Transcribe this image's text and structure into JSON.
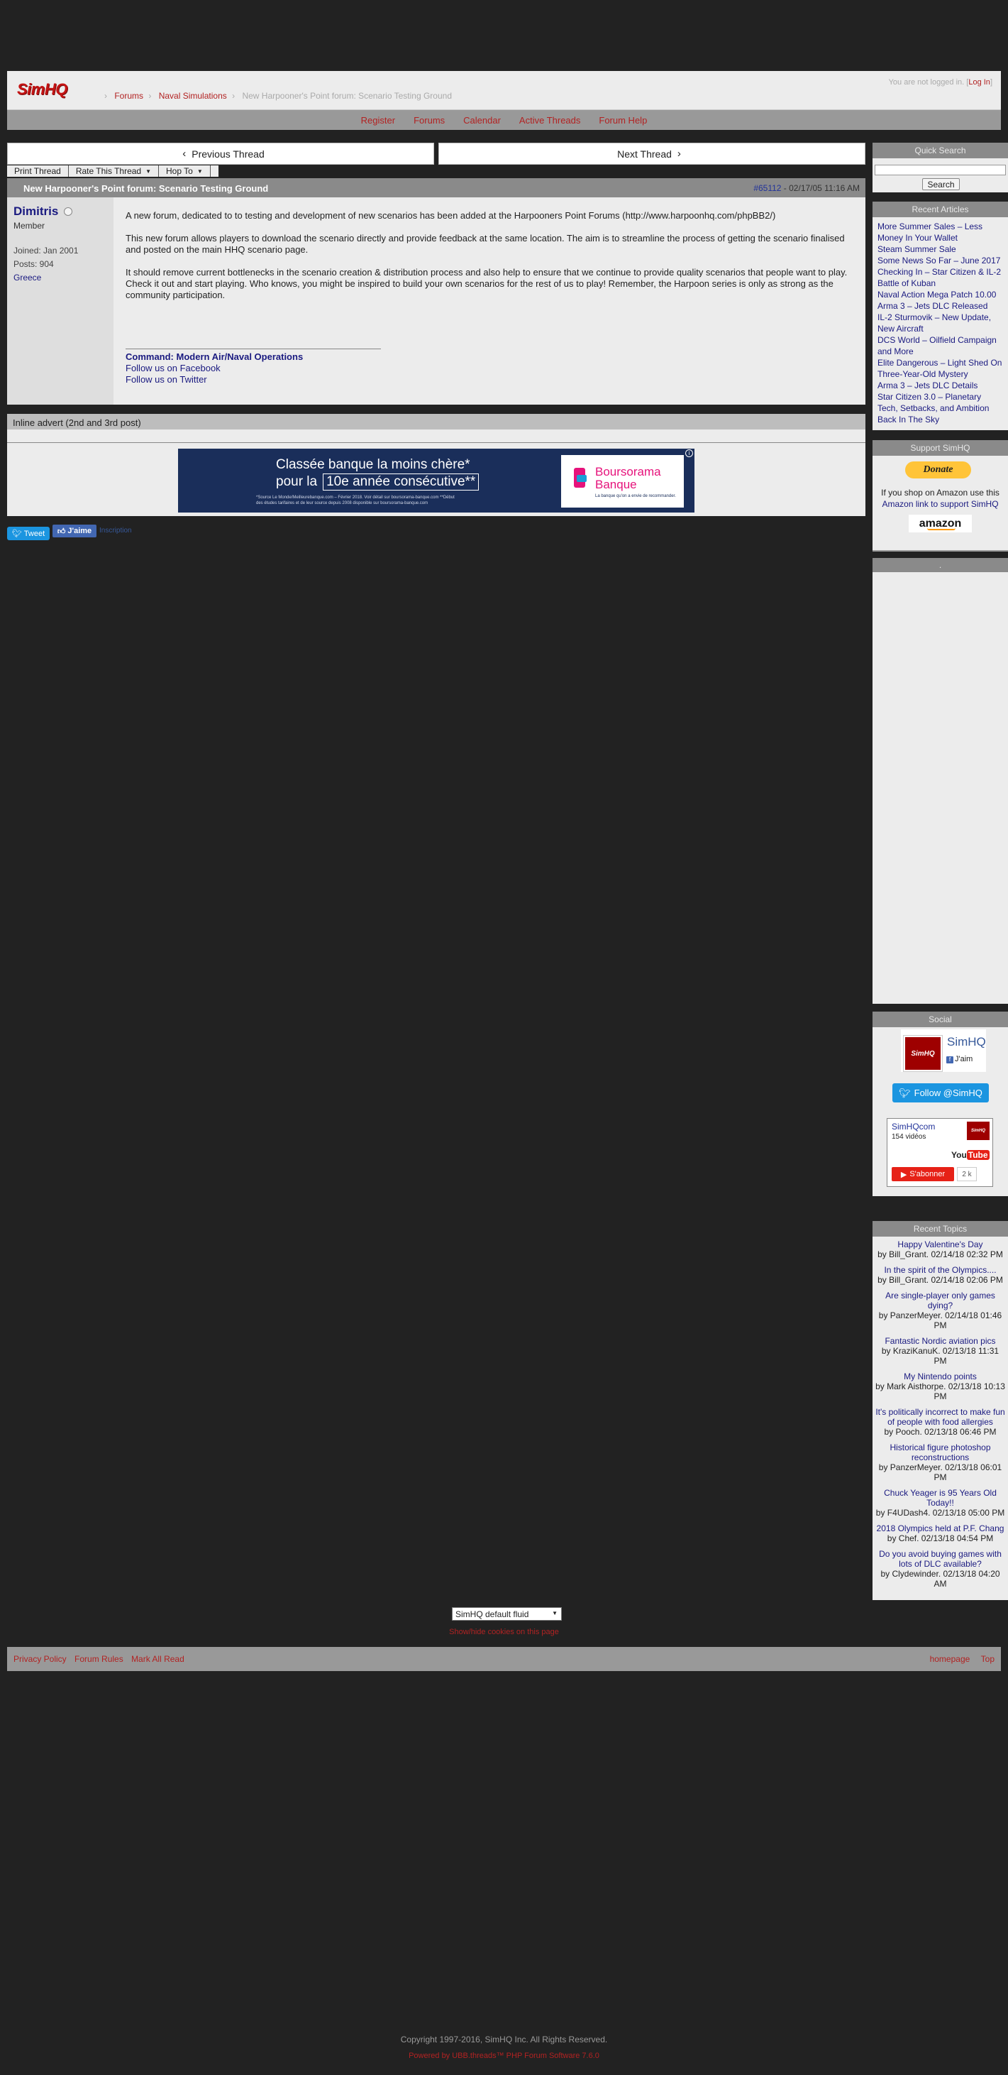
{
  "header": {
    "logo": "SimHQ",
    "breadcrumbs": [
      "Forums",
      "Naval Simulations"
    ],
    "current_page": "New Harpooner's Point forum: Scenario Testing Ground",
    "login_prefix": "You are not logged in. [",
    "login_link": "Log In",
    "login_suffix": "]"
  },
  "navbar": {
    "items": [
      "Register",
      "Forums",
      "Calendar",
      "Active Threads",
      "Forum Help"
    ]
  },
  "thread_nav": {
    "prev": "Previous Thread",
    "next": "Next Thread",
    "prev_icon": "‹",
    "next_icon": "›"
  },
  "tools": {
    "print": "Print Thread",
    "rate": "Rate This Thread",
    "hop": "Hop To"
  },
  "post": {
    "title": "New Harpooner's Point forum: Scenario Testing Ground",
    "number": "#65112",
    "date": " - 02/17/05 11:16 AM",
    "user": {
      "name": "Dimitris",
      "title": "Member",
      "joined": "Joined: Jan 2001",
      "posts": "Posts: 904",
      "location": "Greece"
    },
    "paragraphs": [
      "A new forum, dedicated to to testing and development of new scenarios has been added at the Harpooners Point Forums (http://www.harpoonhq.com/phpBB2/)",
      "This new forum allows players to download the scenario directly and provide feedback at the same location. The aim is to streamline the process of getting the scenario finalised and posted on the main HHQ scenario page.",
      "It should remove current bottlenecks in the scenario creation & distribution process and also help to ensure that we continue to provide quality scenarios that people want to play. Check it out and start playing. Who knows, you might be inspired to build your own scenarios for the rest of us to play! Remember, the Harpoon series is only as strong as the community participation."
    ],
    "signature": {
      "line1": "Command: Modern Air/Naval Operations",
      "line2": "Follow us on Facebook",
      "line3": "Follow us on Twitter"
    }
  },
  "advert": {
    "heading": "Inline advert (2nd and 3rd post)",
    "line1": "Classée banque la moins chère*",
    "line2_prefix": "pour la",
    "line2_box": "10e année consécutive**",
    "small": "*Source Le Monde/Meilleurebanque.com – Février 2018. Voir détail sur boursorama-banque.com **Début des études tarifaires et de leur source depuis 2008 disponible sur boursorama-banque.com",
    "brand1": "Boursorama",
    "brand2": "Banque",
    "tagline": "La banque qu'on a envie de recommander.",
    "close": "i"
  },
  "social_share": {
    "tweet": "Tweet",
    "like": "J'aime",
    "signup": "Inscription"
  },
  "sidebar": {
    "search_title": "Quick Search",
    "search_button": "Search",
    "articles_title": "Recent Articles",
    "articles": [
      "More Summer Sales – Less Money In Your Wallet",
      "Steam Summer Sale",
      "Some News So Far – June 2017",
      "Checking In – Star Citizen & IL-2 Battle of Kuban",
      "Naval Action Mega Patch 10.00",
      "Arma 3 – Jets DLC Released",
      "IL-2 Sturmovik – New Update, New Aircraft",
      "DCS World – Oilfield Campaign and More",
      "Elite Dangerous – Light Shed On Three-Year-Old Mystery",
      "Arma 3 – Jets DLC Details",
      "Star Citizen 3.0 – Planetary Tech, Setbacks, and Ambition",
      "Back In The Sky"
    ],
    "support_title": "Support SimHQ",
    "donate": "Donate",
    "amazon_text1": "If you shop on Amazon use this",
    "amazon_link": "Amazon link to support SimHQ",
    "amazon_logo": "amazon",
    "ad_title": ".",
    "social_title": "Social",
    "fb_name": "SimHQ",
    "fb_like": "J'aim",
    "fb_avatar": "SimHQ",
    "follow": "Follow @SimHQ",
    "yt_name": "SimHQcom",
    "yt_count": "154 vidéos",
    "yt_logo1": "You",
    "yt_logo2": "Tube",
    "yt_subscribe": "S'abonner",
    "yt_subcount": "2 k",
    "topics_title": "Recent Topics",
    "topics": [
      {
        "title": "Happy Valentine's Day",
        "meta": "by Bill_Grant. 02/14/18 02:32 PM"
      },
      {
        "title": "In the spirit of the Olympics....",
        "meta": "by Bill_Grant. 02/14/18 02:06 PM"
      },
      {
        "title": "Are single-player only games dying?",
        "meta": "by PanzerMeyer. 02/14/18 01:46 PM"
      },
      {
        "title": "Fantastic Nordic aviation pics",
        "meta": "by KraziKanuK. 02/13/18 11:31 PM"
      },
      {
        "title": "My Nintendo points",
        "meta": "by Mark Aisthorpe. 02/13/18 10:13 PM"
      },
      {
        "title": "It's politically incorrect to make fun of people with food allergies",
        "meta": "by Pooch. 02/13/18 06:46 PM"
      },
      {
        "title": "Historical figure photoshop reconstructions",
        "meta": "by PanzerMeyer. 02/13/18 06:01 PM"
      },
      {
        "title": "Chuck Yeager is 95 Years Old Today!!",
        "meta": "by F4UDash4. 02/13/18 05:00 PM"
      },
      {
        "title": "2018 Olympics held at P.F. Chang",
        "meta": "by Chef. 02/13/18 04:54 PM"
      },
      {
        "title": "Do you avoid buying games with lots of DLC available?",
        "meta": "by Clydewinder. 02/13/18 04:20 AM"
      }
    ]
  },
  "footer": {
    "style_select": "SimHQ default fluid",
    "cookies": "Show/hide cookies on this page",
    "links_left": [
      "Privacy Policy",
      "Forum Rules",
      "Mark All Read"
    ],
    "links_right": [
      "homepage",
      "Top"
    ],
    "copyright": "Copyright 1997-2016, SimHQ Inc. All Rights Reserved.",
    "powered": "Powered by UBB.threads™ PHP Forum Software 7.6.0"
  },
  "colors": {
    "background": "#222222",
    "link_red": "#b22222",
    "link_blue": "#1a1a80",
    "panel": "#ececec",
    "header_bar": "#8a8a8a"
  }
}
